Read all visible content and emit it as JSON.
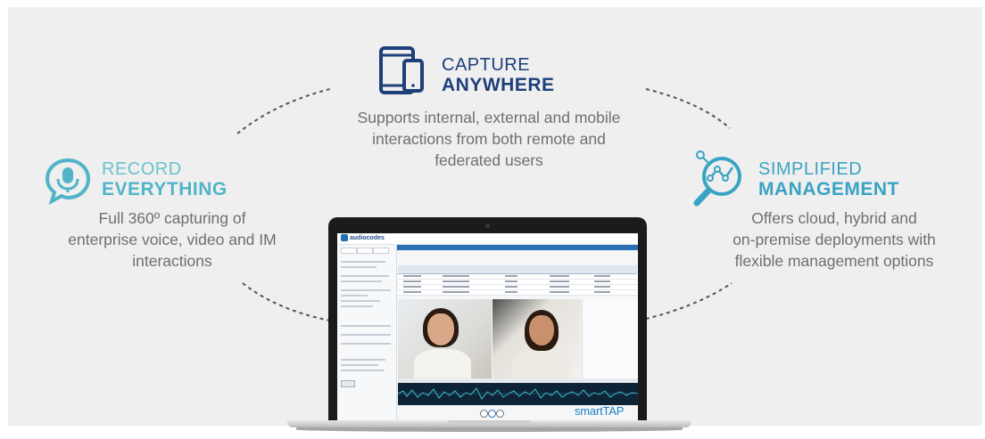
{
  "capture": {
    "title_line1": "CAPTURE",
    "title_line2": "ANYWHERE",
    "description": [
      "Supports internal, external and mobile",
      "interactions from both remote and",
      "federated users"
    ],
    "icon": "devices-icon"
  },
  "record": {
    "title_line1": "RECORD",
    "title_line2": "EVERYTHING",
    "description": [
      "Full 360º capturing of",
      "enterprise voice, video and IM",
      "interactions"
    ],
    "icon": "microphone-chat-icon"
  },
  "simplified": {
    "title_line1": "SIMPLIFIED",
    "title_line2": "MANAGEMENT",
    "description": [
      "Offers cloud, hybrid and",
      "on-premise deployments with",
      "flexible management options"
    ],
    "icon": "magnifier-chart-icon"
  },
  "laptop": {
    "brand": "smartTAP",
    "app_logo": "audiocodes"
  },
  "colors": {
    "navy": "#1d3f7a",
    "teal": "#52b4c9",
    "blue": "#3aa3c4",
    "text_gray": "#6f6f6f",
    "background": "#efefef"
  }
}
